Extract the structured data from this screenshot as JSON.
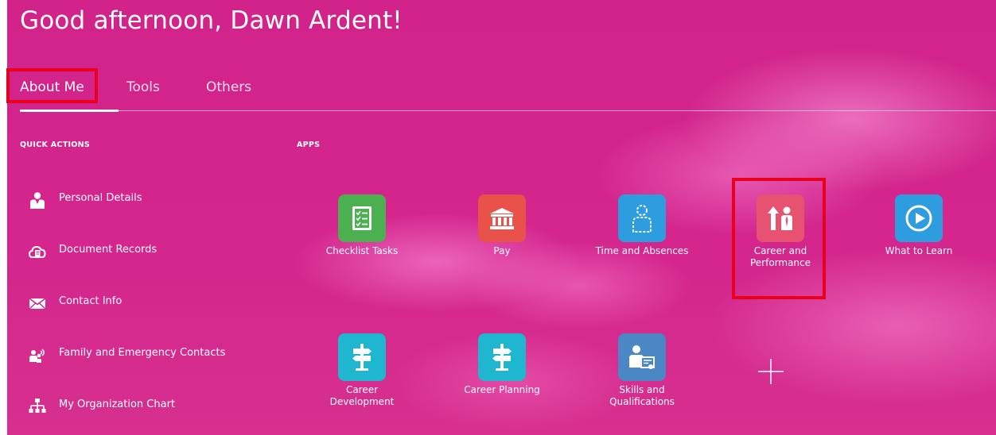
{
  "header": {
    "greeting": "Good afternoon, Dawn Ardent!"
  },
  "tabs": [
    {
      "label": "About Me",
      "selected": true
    },
    {
      "label": "Tools",
      "selected": false
    },
    {
      "label": "Others",
      "selected": false
    }
  ],
  "quick_actions": {
    "title": "QUICK ACTIONS",
    "items": [
      {
        "label": "Personal Details",
        "icon": "person-icon"
      },
      {
        "label": "Document Records",
        "icon": "cloud-document-icon"
      },
      {
        "label": "Contact Info",
        "icon": "envelope-icon"
      },
      {
        "label": "Family and Emergency Contacts",
        "icon": "family-contacts-icon"
      },
      {
        "label": "My Organization Chart",
        "icon": "org-chart-icon"
      }
    ]
  },
  "apps": {
    "title": "APPS",
    "items": [
      {
        "label": "Checklist Tasks",
        "icon": "checklist-icon",
        "color": "#4caf50"
      },
      {
        "label": "Pay",
        "icon": "bank-building-icon",
        "color": "#e8524a"
      },
      {
        "label": "Time and Absences",
        "icon": "person-outline-icon",
        "color": "#2d9de0"
      },
      {
        "label": "Career and Performance",
        "icon": "career-arrow-person-icon",
        "color": "#e65270"
      },
      {
        "label": "What to Learn",
        "icon": "play-circle-icon",
        "color": "#2d9de0"
      },
      {
        "label": "Career Development",
        "icon": "signpost-icon",
        "color": "#1fb6cf"
      },
      {
        "label": "Career Planning",
        "icon": "signpost-icon",
        "color": "#1fb6cf"
      },
      {
        "label": "Skills and Qualifications",
        "icon": "person-certificate-icon",
        "color": "#4b86c5"
      }
    ],
    "add_icon": "plus-icon"
  },
  "colors": {
    "background": "#d1238a",
    "highlight_box": "#e8001c"
  }
}
